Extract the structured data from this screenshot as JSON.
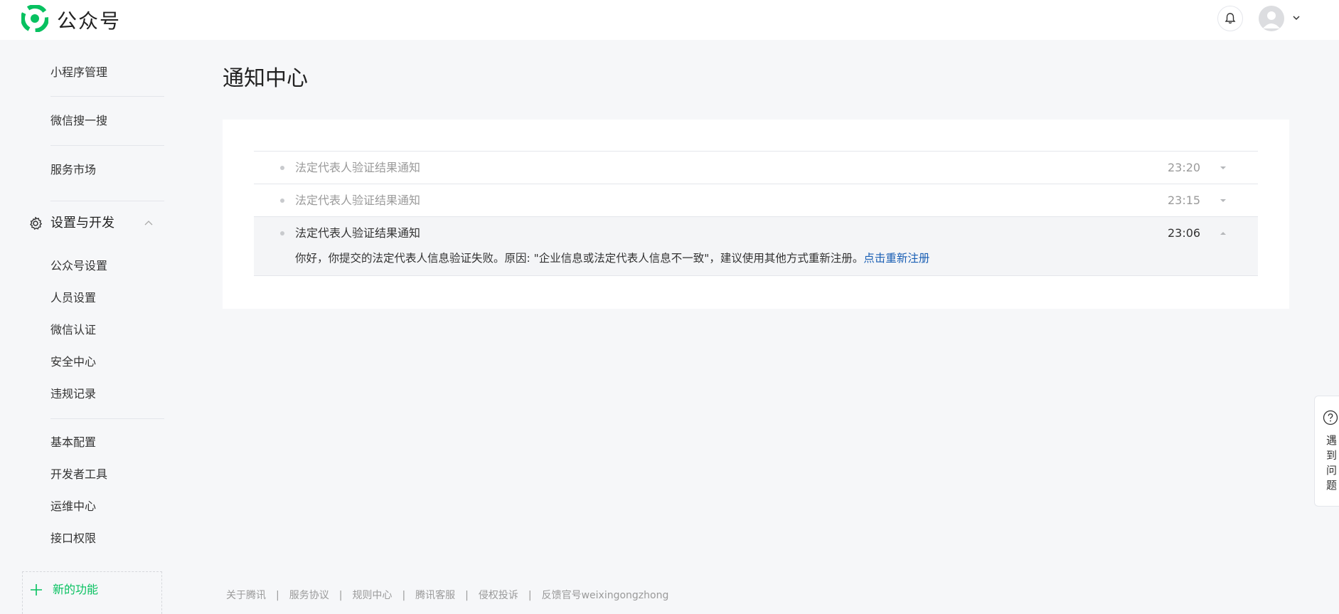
{
  "header": {
    "brand": "公众号",
    "icons": {
      "logo": "wechat-mp-logo",
      "bell": "bell-icon",
      "avatar": "user-avatar",
      "caret": "chevron-down-icon"
    }
  },
  "sidebar": {
    "top_items": [
      {
        "label": "小程序管理"
      },
      {
        "label": "微信搜一搜"
      },
      {
        "label": "服务市场"
      }
    ],
    "section": {
      "label": "设置与开发",
      "icon": "gear-icon",
      "toggle_icon": "chevron-up-icon"
    },
    "section_items_a": [
      {
        "label": "公众号设置"
      },
      {
        "label": "人员设置"
      },
      {
        "label": "微信认证"
      },
      {
        "label": "安全中心"
      },
      {
        "label": "违规记录"
      }
    ],
    "section_items_b": [
      {
        "label": "基本配置"
      },
      {
        "label": "开发者工具"
      },
      {
        "label": "运维中心"
      },
      {
        "label": "接口权限"
      }
    ],
    "new_feature": {
      "label": "新的功能",
      "icon": "plus-icon"
    }
  },
  "main": {
    "title": "通知中心",
    "notifications": [
      {
        "title": "法定代表人验证结果通知",
        "time": "23:20",
        "expanded": false
      },
      {
        "title": "法定代表人验证结果通知",
        "time": "23:15",
        "expanded": false
      },
      {
        "title": "法定代表人验证结果通知",
        "time": "23:06",
        "expanded": true,
        "body": "你好，你提交的法定代表人信息验证失败。原因: \"企业信息或法定代表人信息不一致\"，建议使用其他方式重新注册。",
        "link": "点击重新注册"
      }
    ]
  },
  "footer": {
    "links": [
      "关于腾讯",
      "服务协议",
      "规则中心",
      "腾讯客服",
      "侵权投诉",
      "反馈官号weixingongzhong"
    ],
    "separator": "|"
  },
  "help": {
    "label": "遇到问题",
    "icon": "question-circle-icon"
  },
  "colors": {
    "accent": "#07c160",
    "link": "#1a5fb4",
    "muted": "#9a9a9a",
    "page_bg": "#f6f7f9"
  }
}
